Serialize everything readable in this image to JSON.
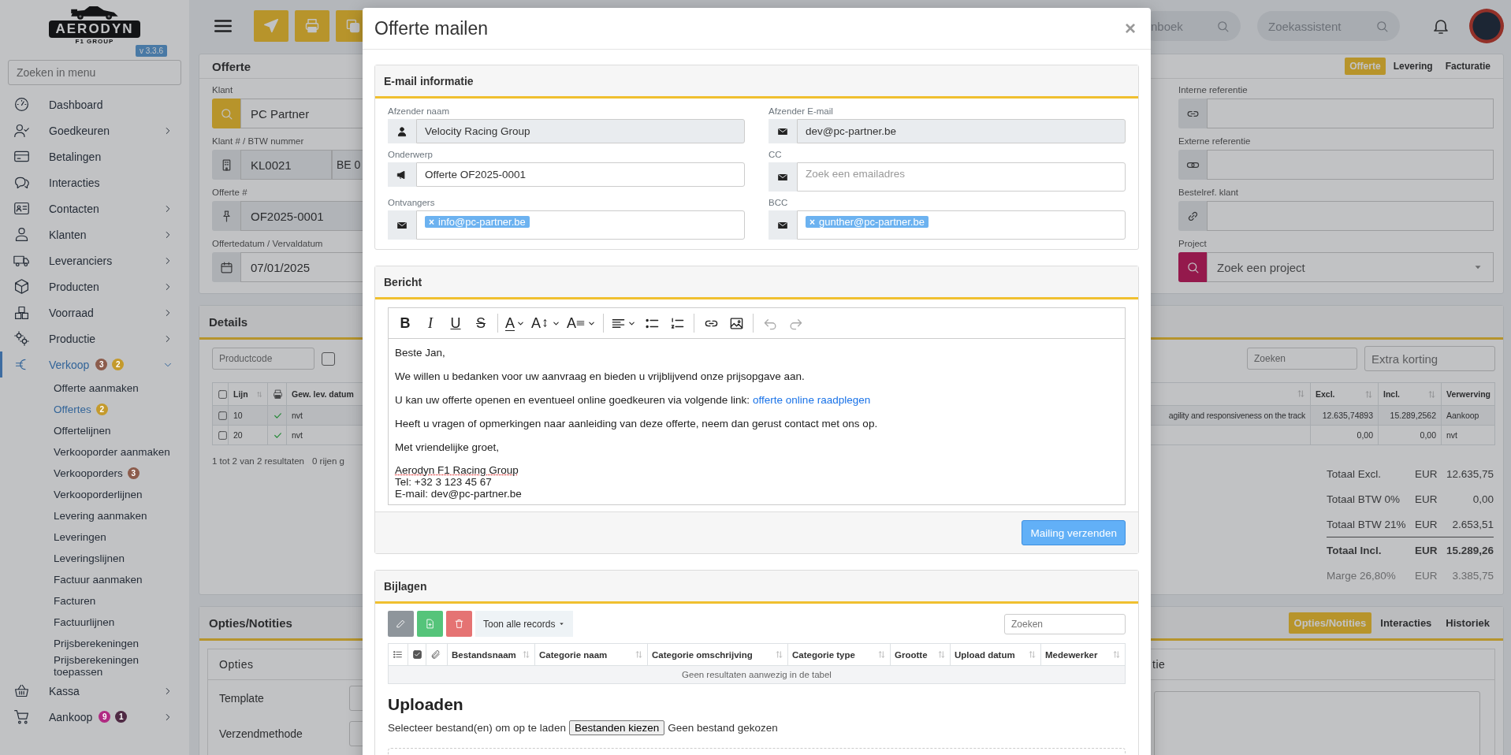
{
  "sidebar": {
    "logo": {
      "name": "AERODYN",
      "tagline": "F1 GROUP"
    },
    "version": "v 3.3.6",
    "search": {
      "placeholder": "Zoeken in menu"
    },
    "items": [
      {
        "label": "Dashboard",
        "selected": false
      },
      {
        "label": "Goedkeuren",
        "selected": false,
        "expanded": false
      },
      {
        "label": "Betalingen",
        "selected": false
      },
      {
        "label": "Interacties",
        "selected": false
      },
      {
        "label": "Contacten",
        "selected": false,
        "expanded": false
      },
      {
        "label": "Klanten",
        "selected": false,
        "expanded": false
      },
      {
        "label": "Leveranciers",
        "selected": false,
        "expanded": false
      },
      {
        "label": "Producten",
        "selected": false,
        "expanded": false
      },
      {
        "label": "Voorraad",
        "selected": false,
        "expanded": false
      },
      {
        "label": "Productie",
        "selected": false,
        "expanded": false
      },
      {
        "label": "Verkoop",
        "selected": true,
        "expanded": true,
        "badges": [
          {
            "text": "3",
            "color": "#8c5c4c"
          },
          {
            "text": "2",
            "color": "#c49a2c"
          }
        ],
        "children": [
          {
            "label": "Offerte aanmaken",
            "selected": false
          },
          {
            "label": "Offertes",
            "selected": true,
            "badges": [
              {
                "text": "2",
                "color": "#c49a2c"
              }
            ]
          },
          {
            "label": "Offertelijnen",
            "selected": false
          },
          {
            "label": "Verkooporder aanmaken",
            "selected": false
          },
          {
            "label": "Verkooporders",
            "selected": false,
            "badges": [
              {
                "text": "3",
                "color": "#8c5c4c"
              }
            ]
          },
          {
            "label": "Verkooporderlijnen",
            "selected": false
          },
          {
            "label": "Levering aanmaken",
            "selected": false
          },
          {
            "label": "Leveringen",
            "selected": false
          },
          {
            "label": "Leveringslijnen",
            "selected": false
          },
          {
            "label": "Factuur aanmaken",
            "selected": false
          },
          {
            "label": "Facturen",
            "selected": false
          },
          {
            "label": "Factuurlijnen",
            "selected": false
          },
          {
            "label": "Prijsberekeningen",
            "selected": false
          },
          {
            "label": "Prijsberekeningen toepassen",
            "selected": false
          }
        ]
      },
      {
        "label": "Kassa",
        "selected": false,
        "expanded": false
      },
      {
        "label": "Aankoop",
        "selected": false,
        "expanded": false,
        "badges": [
          {
            "text": "9",
            "color": "#b02a82"
          },
          {
            "text": "1",
            "color": "#4f2a44"
          }
        ]
      }
    ]
  },
  "topbar": {
    "searches": [
      {
        "placeholder": "nboek"
      },
      {
        "placeholder": "Zoekassistent"
      }
    ]
  },
  "quote_card": {
    "title": "Offerte",
    "tabs": [
      {
        "label": "Offerte",
        "selected": true
      },
      {
        "label": "Levering",
        "selected": false
      },
      {
        "label": "Facturatie",
        "selected": false
      }
    ],
    "left_fields": [
      {
        "label": "Klant",
        "kind": "customer",
        "values": [
          "PC Partner"
        ]
      },
      {
        "label": "Klant # / BTW nummer",
        "kind": "split",
        "values": [
          "KL0021",
          "BE 0"
        ]
      },
      {
        "label": "Offerte #",
        "kind": "number",
        "values": [
          "OF2025-0001"
        ]
      },
      {
        "label": "Offertedatum / Vervaldatum",
        "kind": "date",
        "values": [
          "07/01/2025"
        ]
      }
    ],
    "right_fields": [
      {
        "label": "Interne referentie",
        "kind": "link"
      },
      {
        "label": "Externe referentie",
        "kind": "rings"
      },
      {
        "label": "Bestelref. klant",
        "kind": "chain"
      },
      {
        "label": "Project",
        "kind": "project",
        "placeholder": "Zoek een project"
      }
    ]
  },
  "details": {
    "title": "Details",
    "productcode_placeholder": "Productcode",
    "filter_checked": false,
    "search_placeholder": "Zoeken",
    "discount_placeholder": "Extra korting",
    "headers": {
      "line": "Lijn",
      "date": "Gew. lev. datum",
      "excl": "Excl.",
      "incl": "Incl.",
      "acquisition": "Verwerving"
    },
    "rows": [
      {
        "selected": false,
        "line": "10",
        "printed": true,
        "date": "nvt",
        "description": "agility and responsiveness on the track",
        "excl": "12.635,74893",
        "incl": "15.289,2562",
        "acquisition": "Aankoop"
      },
      {
        "selected": false,
        "line": "20",
        "printed": true,
        "date": "nvt",
        "excl": "0,00",
        "incl": "0,00",
        "acquisition": "nvt"
      }
    ],
    "summary": "1 tot 2 van 2 resultaten",
    "selection_info": "0 rijen g",
    "totals": [
      {
        "kind": "normal",
        "label": "Totaal Excl.",
        "currency": "EUR",
        "amount": "12.635,75"
      },
      {
        "kind": "normal",
        "label": "Totaal BTW 0%",
        "currency": "EUR",
        "amount": "0,00"
      },
      {
        "kind": "normal",
        "label": "Totaal BTW 21%",
        "currency": "EUR",
        "amount": "2.653,51"
      },
      {
        "kind": "total",
        "label": "Totaal Incl.",
        "currency": "EUR",
        "amount": "15.289,26"
      },
      {
        "kind": "muted",
        "label": "Marge 26,80%",
        "currency": "EUR",
        "amount": "3.385,75"
      }
    ]
  },
  "notes_card": {
    "title": "Opties/Notities",
    "tabs": [
      {
        "label": "Opties/Notities",
        "selected": true
      },
      {
        "label": "Interacties",
        "selected": false
      },
      {
        "label": "Historiek",
        "selected": false
      }
    ],
    "options": {
      "title": "Opties",
      "rows": [
        "Template",
        "Verzendmethode"
      ]
    },
    "notes": {
      "title": "tie"
    }
  },
  "modal": {
    "title": "Offerte mailen",
    "close": "×",
    "email_info": {
      "title": "E-mail informatie",
      "fields": [
        {
          "label": "Afzender naam",
          "kind": "person",
          "readonly": true,
          "value": "Velocity Racing Group"
        },
        {
          "label": "Afzender E-mail",
          "kind": "mail",
          "readonly": true,
          "value": "dev@pc-partner.be"
        },
        {
          "label": "Onderwerp",
          "kind": "megaphone",
          "readonly": false,
          "value": "Offerte OF2025-0001"
        },
        {
          "label": "CC",
          "kind": "mail",
          "readonly": false,
          "placeholder": "Zoek een emailadres"
        },
        {
          "label": "Ontvangers",
          "kind": "mail",
          "readonly": false,
          "tags": [
            {
              "remove": "×",
              "text": "info@pc-partner.be"
            }
          ]
        },
        {
          "label": "BCC",
          "kind": "mail",
          "readonly": false,
          "tags": [
            {
              "remove": "×",
              "text": "gunther@pc-partner.be"
            }
          ]
        }
      ]
    },
    "message": {
      "title": "Bericht",
      "toolbar": [
        {
          "kind": "bold",
          "label": "B",
          "dropdown": false,
          "disabled": false
        },
        {
          "kind": "italic",
          "label": "I",
          "dropdown": false,
          "disabled": false
        },
        {
          "kind": "underline",
          "label": "U",
          "dropdown": false,
          "disabled": false
        },
        {
          "kind": "strike",
          "label": "S",
          "dropdown": false,
          "disabled": false
        },
        {
          "kind": "color",
          "label": "A",
          "dropdown": true,
          "disabled": false
        },
        {
          "kind": "size",
          "label": "A",
          "dropdown": true,
          "disabled": false
        },
        {
          "kind": "format",
          "label": "A",
          "dropdown": true,
          "disabled": false
        },
        {
          "kind": "align",
          "dropdown": true,
          "disabled": false
        },
        {
          "kind": "bullets",
          "dropdown": false,
          "disabled": false
        },
        {
          "kind": "numbers",
          "dropdown": false,
          "disabled": false
        },
        {
          "kind": "link",
          "dropdown": false,
          "disabled": false
        },
        {
          "kind": "image",
          "dropdown": false,
          "disabled": false
        },
        {
          "kind": "undo",
          "dropdown": false,
          "disabled": true
        },
        {
          "kind": "redo",
          "dropdown": false,
          "disabled": true
        }
      ],
      "paragraphs": [
        {
          "text": "Beste Jan,"
        },
        {
          "text": "We willen u bedanken voor uw aanvraag en bieden u vrijblijvend onze prijsopgave aan."
        },
        {
          "text": "U kan uw offerte openen en eventueel online goedkeuren via volgende link:",
          "link": "offerte online raadplegen"
        },
        {
          "text": "Heeft u vragen of opmerkingen naar aanleiding van deze offerte, neem dan gerust contact met ons op."
        },
        {
          "text": "Met vriendelijke groet,"
        }
      ],
      "signature": [
        "Aerodyn F1 Racing Group",
        "Tel: +32 3 123 45 67",
        "E-mail: dev@pc-partner.be"
      ],
      "send_button": "Mailing verzenden"
    },
    "attachments": {
      "title": "Bijlagen",
      "records_button": "Toon alle records",
      "search_placeholder": "Zoeken",
      "select_all_checked": true,
      "columns": [
        "Bestandsnaam",
        "Categorie naam",
        "Categorie omschrijving",
        "Categorie type",
        "Grootte",
        "Upload datum",
        "Medewerker"
      ],
      "empty": "Geen resultaten aanwezig in de tabel",
      "upload": {
        "title": "Uploaden",
        "label": "Selecteer bestand(en) om op te laden",
        "button": "Bestanden kiezen",
        "status": "Geen bestand gekozen"
      }
    }
  }
}
